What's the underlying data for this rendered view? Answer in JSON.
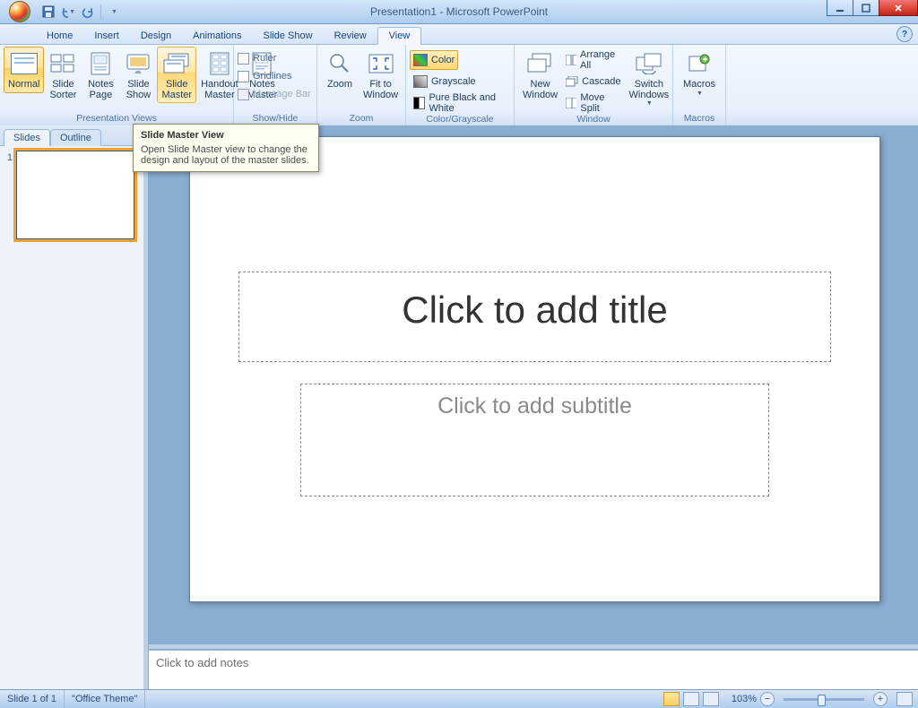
{
  "title": "Presentation1 - Microsoft PowerPoint",
  "tabs": [
    "Home",
    "Insert",
    "Design",
    "Animations",
    "Slide Show",
    "Review",
    "View"
  ],
  "active_tab": "View",
  "ribbon": {
    "presentation_views": {
      "label": "Presentation Views",
      "items": [
        "Normal",
        "Slide\nSorter",
        "Notes\nPage",
        "Slide\nShow",
        "Slide\nMaster",
        "Handout\nMaster",
        "Notes\nMaster"
      ]
    },
    "show_hide": {
      "label": "Show/Hide",
      "items": [
        "Ruler",
        "Gridlines",
        "Message Bar"
      ]
    },
    "zoom": {
      "label": "Zoom",
      "zoom": "Zoom",
      "fit": "Fit to\nWindow"
    },
    "color_grayscale": {
      "label": "Color/Grayscale",
      "color": "Color",
      "grayscale": "Grayscale",
      "bw": "Pure Black and White"
    },
    "window": {
      "label": "Window",
      "new": "New\nWindow",
      "arrange": "Arrange All",
      "cascade": "Cascade",
      "move_split": "Move Split",
      "switch": "Switch\nWindows"
    },
    "macros": {
      "label": "Macros",
      "btn": "Macros"
    }
  },
  "left_panel": {
    "slides_tab": "Slides",
    "outline_tab": "Outline",
    "slide_number": "1"
  },
  "slide": {
    "title_placeholder": "Click to add title",
    "subtitle_placeholder": "Click to add subtitle"
  },
  "notes": {
    "placeholder": "Click to add notes"
  },
  "tooltip": {
    "title": "Slide Master View",
    "body": "Open Slide Master view to change the design and layout of the master slides."
  },
  "status": {
    "slide": "Slide 1 of 1",
    "theme": "\"Office Theme\"",
    "zoom": "103%"
  }
}
